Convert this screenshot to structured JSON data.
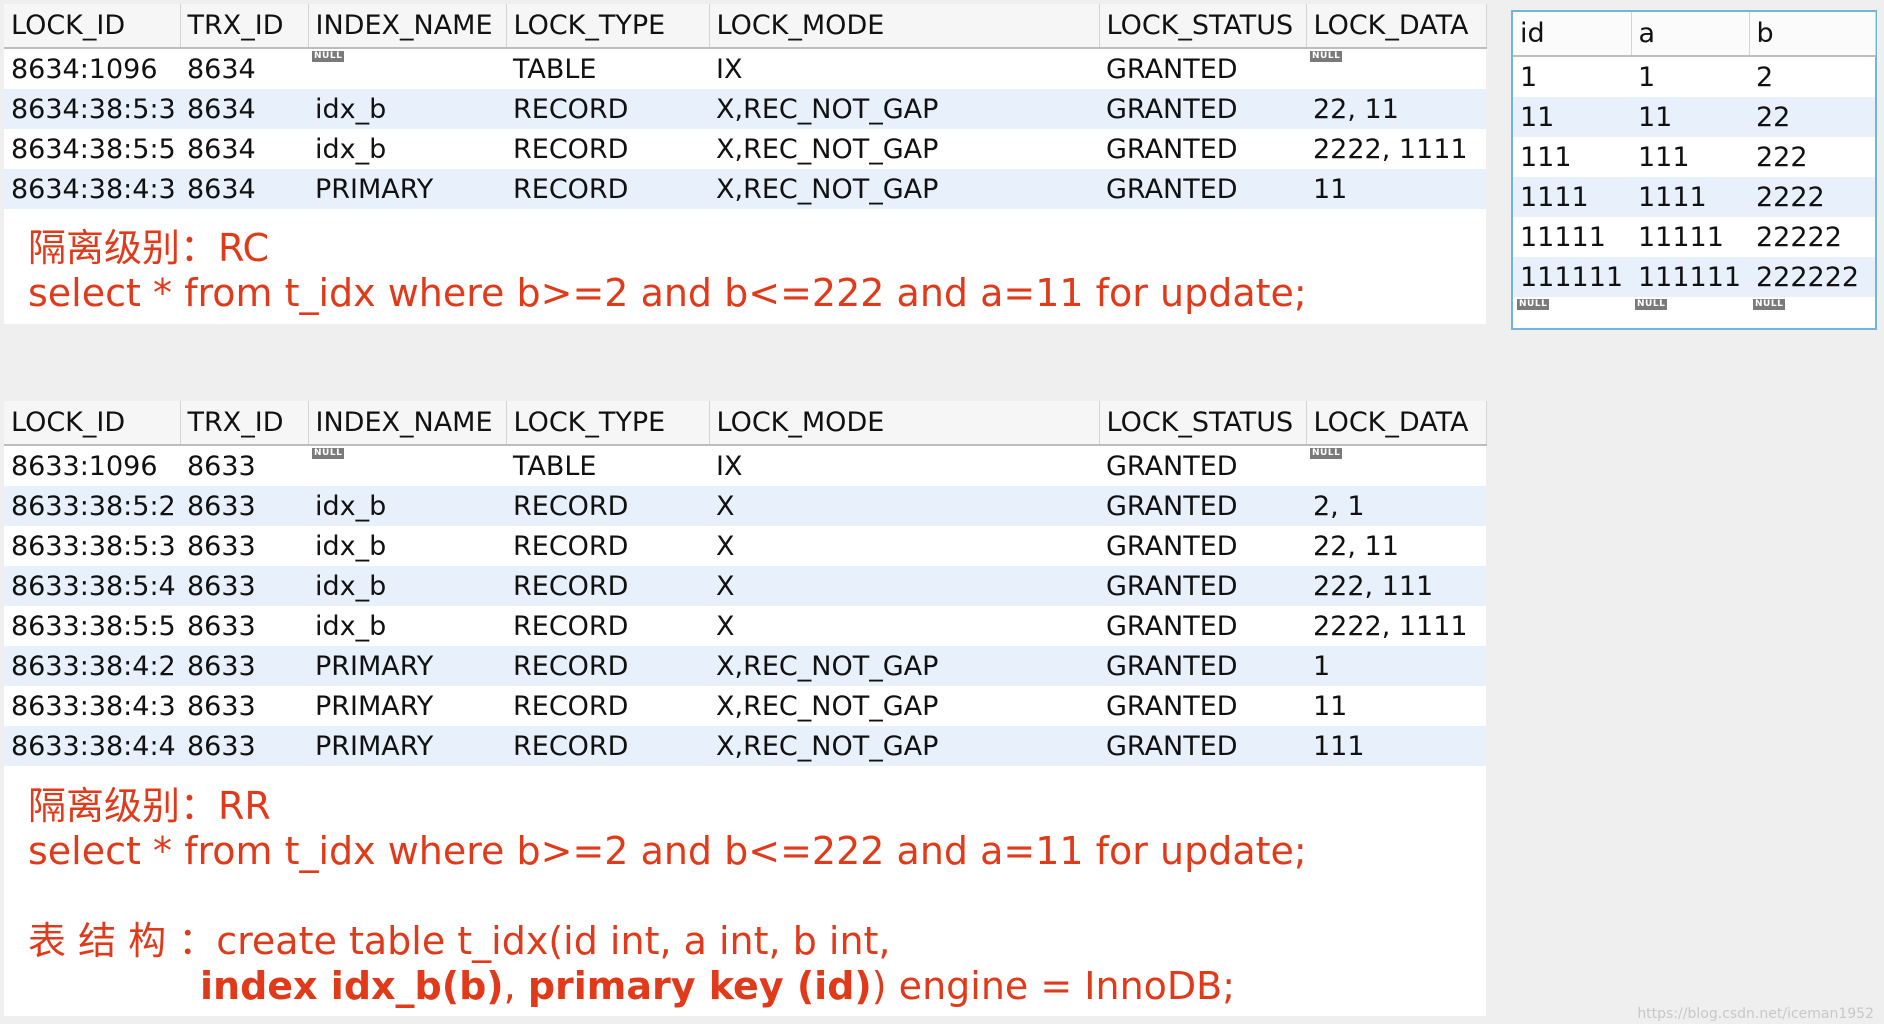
{
  "null_badge": "NULL",
  "columns": [
    "LOCK_ID",
    "TRX_ID",
    "INDEX_NAME",
    "LOCK_TYPE",
    "LOCK_MODE",
    "LOCK_STATUS",
    "LOCK_DATA"
  ],
  "rc_table": {
    "rows": [
      [
        "8634:1096",
        "8634",
        null,
        "TABLE",
        "IX",
        "GRANTED",
        null
      ],
      [
        "8634:38:5:3",
        "8634",
        "idx_b",
        "RECORD",
        "X,REC_NOT_GAP",
        "GRANTED",
        "22, 11"
      ],
      [
        "8634:38:5:5",
        "8634",
        "idx_b",
        "RECORD",
        "X,REC_NOT_GAP",
        "GRANTED",
        "2222, 1111"
      ],
      [
        "8634:38:4:3",
        "8634",
        "PRIMARY",
        "RECORD",
        "X,REC_NOT_GAP",
        "GRANTED",
        "11"
      ]
    ]
  },
  "rc_caption": {
    "line1": "隔离级别：RC",
    "line2": "select * from t_idx where b>=2 and b<=222 and a=11 for update;"
  },
  "rr_table": {
    "rows": [
      [
        "8633:1096",
        "8633",
        null,
        "TABLE",
        "IX",
        "GRANTED",
        null
      ],
      [
        "8633:38:5:2",
        "8633",
        "idx_b",
        "RECORD",
        "X",
        "GRANTED",
        "2, 1"
      ],
      [
        "8633:38:5:3",
        "8633",
        "idx_b",
        "RECORD",
        "X",
        "GRANTED",
        "22, 11"
      ],
      [
        "8633:38:5:4",
        "8633",
        "idx_b",
        "RECORD",
        "X",
        "GRANTED",
        "222, 111"
      ],
      [
        "8633:38:5:5",
        "8633",
        "idx_b",
        "RECORD",
        "X",
        "GRANTED",
        "2222, 1111"
      ],
      [
        "8633:38:4:2",
        "8633",
        "PRIMARY",
        "RECORD",
        "X,REC_NOT_GAP",
        "GRANTED",
        "1"
      ],
      [
        "8633:38:4:3",
        "8633",
        "PRIMARY",
        "RECORD",
        "X,REC_NOT_GAP",
        "GRANTED",
        "11"
      ],
      [
        "8633:38:4:4",
        "8633",
        "PRIMARY",
        "RECORD",
        "X,REC_NOT_GAP",
        "GRANTED",
        "111"
      ]
    ]
  },
  "rr_caption": {
    "line1": "隔离级别：RR",
    "line2": "select * from t_idx where b>=2 and b<=222 and a=11 for update;"
  },
  "schema_caption": {
    "label": "表 结 构 ：",
    "line1": "create table t_idx(id int, a int, b int,",
    "index_part": "index idx_b(b)",
    "comma": ", ",
    "pk_part": "primary key (id)",
    "end_part": ") engine = InnoDB;"
  },
  "data_table": {
    "columns": [
      "id",
      "a",
      "b"
    ],
    "rows": [
      [
        "1",
        "1",
        "2"
      ],
      [
        "11",
        "11",
        "22"
      ],
      [
        "111",
        "111",
        "222"
      ],
      [
        "1111",
        "1111",
        "2222"
      ],
      [
        "11111",
        "11111",
        "22222"
      ],
      [
        "111111",
        "111111",
        "222222"
      ]
    ]
  },
  "watermark": "https://blog.csdn.net/iceman1952"
}
